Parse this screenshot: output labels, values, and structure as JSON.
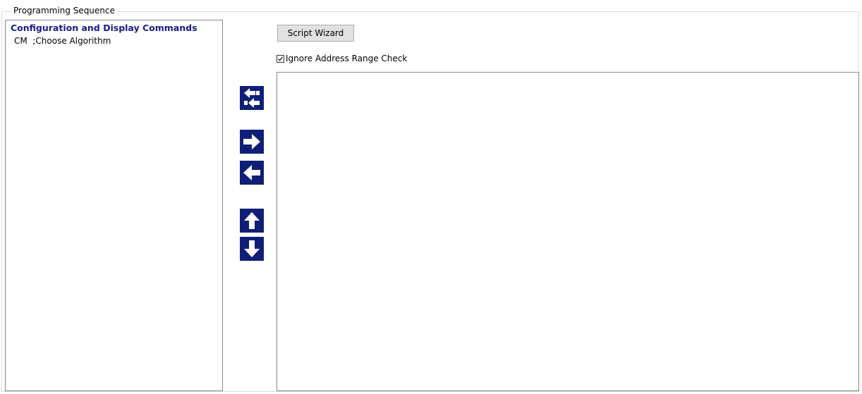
{
  "group": {
    "title": "Programming Sequence"
  },
  "command_list": {
    "category_header": "Configuration and Display Commands",
    "items": [
      {
        "label": "CM  ;Choose Algorithm"
      }
    ]
  },
  "toolbar": {
    "script_wizard_label": "Script Wizard",
    "buttons": [
      {
        "name": "swap",
        "icon": "swap-arrows-icon"
      },
      {
        "name": "add-right",
        "icon": "arrow-right-icon"
      },
      {
        "name": "remove-left",
        "icon": "arrow-left-icon"
      },
      {
        "name": "move-up",
        "icon": "arrow-up-icon"
      },
      {
        "name": "move-down",
        "icon": "arrow-down-icon"
      }
    ],
    "button_color": "#0f1f78"
  },
  "options": {
    "ignore_address_range_label": "Ignore Address Range Check",
    "ignore_address_range_checked": true
  },
  "script": {
    "lines": []
  }
}
